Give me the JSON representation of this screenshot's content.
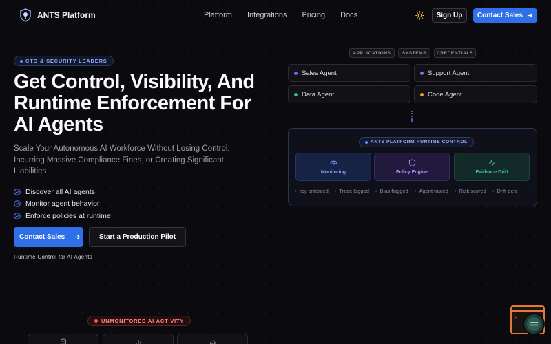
{
  "nav": {
    "brand": "ANTS Platform",
    "links": [
      "Platform",
      "Integrations",
      "Pricing",
      "Docs"
    ],
    "signup": "Sign Up",
    "contact": "Contact Sales"
  },
  "hero": {
    "badge": "CTO & SECURITY LEADERS",
    "title": "Get Control, Visibility, And Runtime Enforcement For AI Agents",
    "subtitle": "Scale Your Autonomous AI Workforce Without Losing Control, Incurring Massive Compliance Fines, or Creating Significant Liabilities",
    "checks": [
      "Discover all AI agents",
      "Monitor agent behavior",
      "Enforce policies at runtime"
    ],
    "cta_primary": "Contact Sales",
    "cta_secondary": "Start a Production Pilot",
    "caption": "Runtime Control for AI Agents"
  },
  "diagram": {
    "chips": [
      "APPLICATIONS",
      "SYSTEMS",
      "CREDENTIALS"
    ],
    "agents": [
      {
        "label": "Sales Agent",
        "color": "#5b6cff"
      },
      {
        "label": "Support Agent",
        "color": "#8b6cff"
      },
      {
        "label": "Data Agent",
        "color": "#2fbf71"
      },
      {
        "label": "Code Agent",
        "color": "#f0a030"
      }
    ],
    "panel_title": "ANTS PLATFORM RUNTIME CONTROL",
    "tiles": [
      "Monitoring",
      "Policy Engine",
      "Evidence Drift"
    ],
    "ticker": [
      "licy enforced",
      "Trace logged",
      "Bias flagged",
      "Agent traced",
      "Risk scored",
      "Drift dete"
    ]
  },
  "bottom": {
    "badge": "UNMONITORED AI ACTIVITY"
  },
  "widget": {
    "terminal_text": ">_"
  },
  "colors": {
    "accent": "#2f6fe8",
    "background": "#0b0b0f"
  }
}
